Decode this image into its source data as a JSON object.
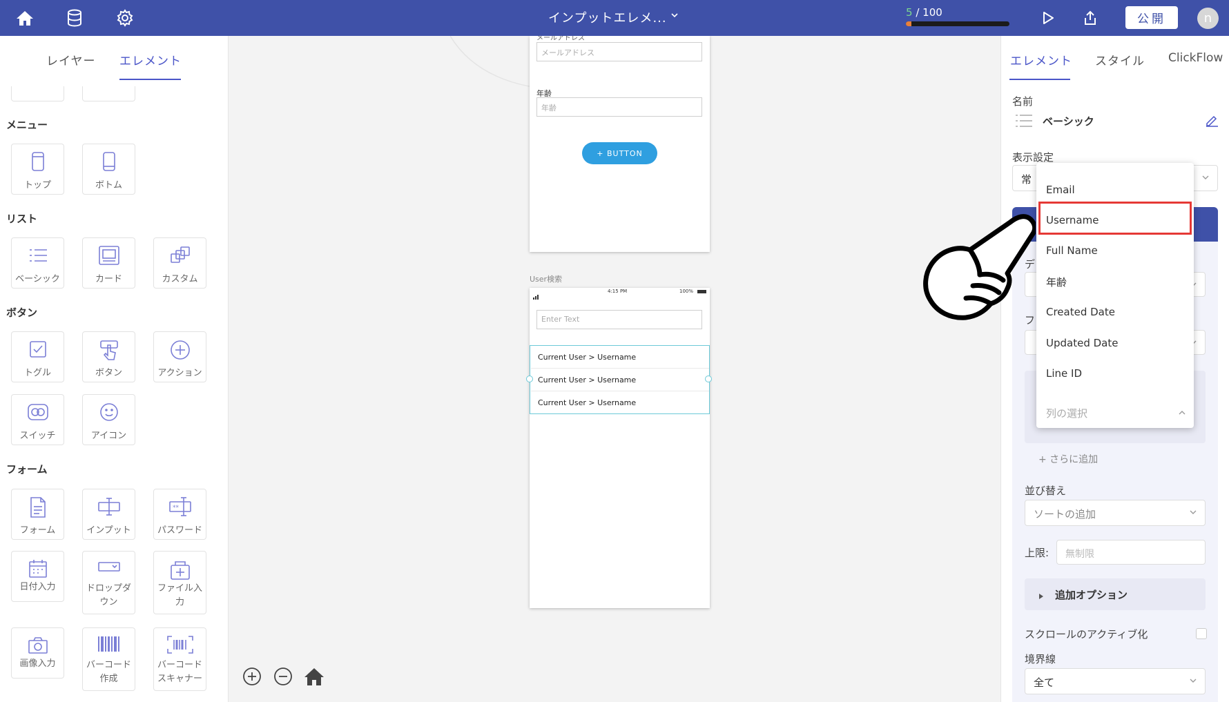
{
  "topbar": {
    "title": "インプットエレメ...",
    "progress_done": "5",
    "progress_total": "/ 100",
    "progress_fraction": 0.05,
    "publish_label": "公開",
    "avatar_letter": "n",
    "icons": [
      "home-icon",
      "database-icon",
      "gear-icon",
      "chevron-down-icon",
      "play-icon",
      "share-icon"
    ]
  },
  "left_panel": {
    "tabs": [
      "レイヤー",
      "エレメント"
    ],
    "active_tab": "エレメント",
    "sections": {
      "menu": "メニュー",
      "list": "リスト",
      "button": "ボタン",
      "form": "フォーム"
    },
    "tiles": {
      "top": "トップ",
      "bottom": "ボトム",
      "basic": "ベーシック",
      "card": "カード",
      "custom": "カスタム",
      "toggle": "トグル",
      "button": "ボタン",
      "action": "アクション",
      "switch": "スイッチ",
      "icon": "アイコン",
      "form": "フォーム",
      "input": "インプット",
      "password": "パスワード",
      "date_input": "日付入力",
      "dropdown_l1": "ドロップダ",
      "dropdown_l2": "ウン",
      "file_input_l1": "ファイル入",
      "file_input_l2": "力",
      "image_input": "画像入力",
      "barcode_l1": "バーコード",
      "barcode_l2": "作成",
      "barcode_scanner_l1": "バーコード",
      "barcode_scanner_l2": "スキャナー"
    }
  },
  "canvas": {
    "screen1": {
      "cut_label": "メールアドレス",
      "email_placeholder": "メールアドレス",
      "age_label": "年齢",
      "age_placeholder": "年齢",
      "button_label": "+ BUTTON"
    },
    "screen2": {
      "name": "User検索",
      "status_time": "4:15 PM",
      "status_battery": "100%",
      "search_placeholder": "Enter Text",
      "rows": [
        "Current User > Username",
        "Current User > Username",
        "Current User > Username"
      ]
    }
  },
  "right_panel": {
    "tabs": [
      "エレメント",
      "スタイル",
      "ClickFlow"
    ],
    "active_tab": "エレメント",
    "name_label": "名前",
    "name_value": "ベーシック",
    "display_label": "表示設定",
    "display_value_partial": "常",
    "partial_label_1": "デ",
    "partial_label_2": "フ",
    "add_more": "+ さらに追加",
    "sort_label": "並び替え",
    "sort_placeholder": "ソートの追加",
    "limit_label": "上限:",
    "limit_placeholder": "無制限",
    "extra_options": "追加オプション",
    "scroll_active": "スクロールのアクティブ化",
    "border_label": "境界線",
    "border_value": "全て"
  },
  "dropdown": {
    "items": [
      "Email",
      "Username",
      "Full Name",
      "年齢",
      "Created Date",
      "Updated Date",
      "Line ID"
    ],
    "highlighted": "Username",
    "footer_placeholder": "列の選択"
  },
  "colors": {
    "topbar": "#3f51a8",
    "accent": "#4a55c8",
    "canvas_button": "#2f9fe0",
    "highlight": "#e53935"
  }
}
